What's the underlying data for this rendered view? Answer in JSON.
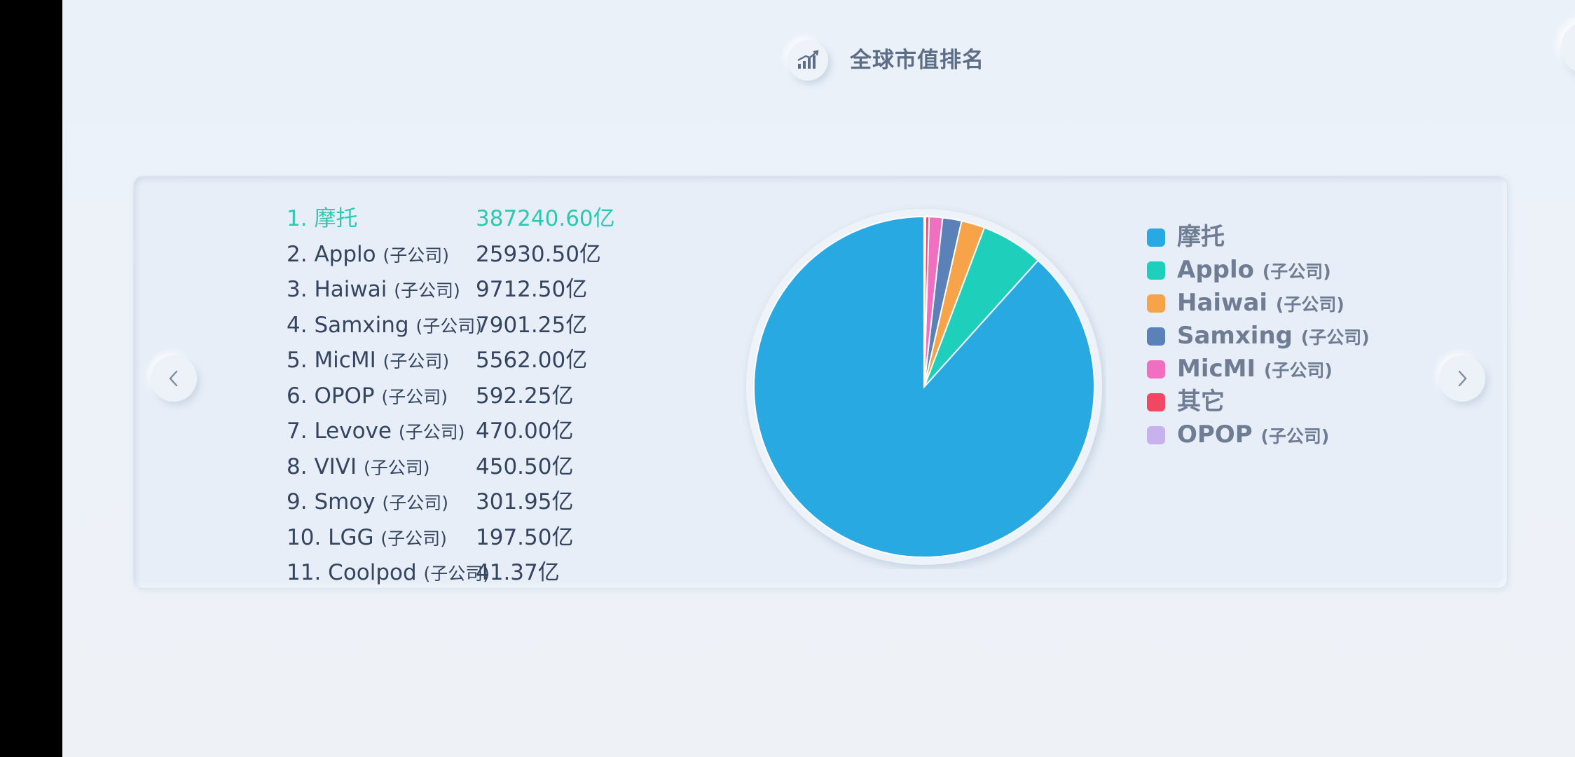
{
  "header": {
    "title": "全球市值排名",
    "icon": "trend-chart-icon"
  },
  "colors": {
    "accent": "#2cc9b0",
    "text": "#34455f",
    "legend_text": "#6f7d94"
  },
  "ranking": [
    {
      "rank": "1.",
      "name": "摩托",
      "suffix": "",
      "value": "387240.60亿"
    },
    {
      "rank": "2.",
      "name": "Applo",
      "suffix": "(子公司)",
      "value": "25930.50亿"
    },
    {
      "rank": "3.",
      "name": "Haiwai",
      "suffix": "(子公司)",
      "value": "9712.50亿"
    },
    {
      "rank": "4.",
      "name": "Samxing",
      "suffix": "(子公司)",
      "value": "7901.25亿"
    },
    {
      "rank": "5.",
      "name": "MicMI",
      "suffix": "(子公司)",
      "value": "5562.00亿"
    },
    {
      "rank": "6.",
      "name": "OPOP",
      "suffix": "(子公司)",
      "value": "592.25亿"
    },
    {
      "rank": "7.",
      "name": "Levove",
      "suffix": "(子公司)",
      "value": "470.00亿"
    },
    {
      "rank": "8.",
      "name": "VIVI",
      "suffix": "(子公司)",
      "value": "450.50亿"
    },
    {
      "rank": "9.",
      "name": "Smoy",
      "suffix": "(子公司)",
      "value": "301.95亿"
    },
    {
      "rank": "10.",
      "name": "LGG",
      "suffix": "(子公司)",
      "value": "197.50亿"
    },
    {
      "rank": "11.",
      "name": "Coolpod",
      "suffix": "(子公司)",
      "value": "41.37亿"
    }
  ],
  "legend": [
    {
      "name": "摩托",
      "suffix": "",
      "color": "#29a9e1"
    },
    {
      "name": "Applo",
      "suffix": "(子公司)",
      "color": "#1ecfbb"
    },
    {
      "name": "Haiwai",
      "suffix": "(子公司)",
      "color": "#f6a34a"
    },
    {
      "name": "Samxing",
      "suffix": "(子公司)",
      "color": "#5b82b8"
    },
    {
      "name": "MicMI",
      "suffix": "(子公司)",
      "color": "#f06fc0"
    },
    {
      "name": "其它",
      "suffix": "",
      "color": "#f04862"
    },
    {
      "name": "OPOP",
      "suffix": "(子公司)",
      "color": "#c8b2ee"
    }
  ],
  "chart_data": {
    "type": "pie",
    "slices": [
      {
        "name": "摩托",
        "value": 387240.6,
        "color": "#29a9e1"
      },
      {
        "name": "Applo",
        "value": 25930.5,
        "color": "#1ecfbb"
      },
      {
        "name": "Haiwai",
        "value": 9712.5,
        "color": "#f6a34a"
      },
      {
        "name": "Samxing",
        "value": 7901.25,
        "color": "#5b82b8"
      },
      {
        "name": "MicMI",
        "value": 5562.0,
        "color": "#f06fc0"
      },
      {
        "name": "其它",
        "value": 1461.32,
        "color": "#f04862"
      },
      {
        "name": "OPOP",
        "value": 592.25,
        "color": "#c8b2ee"
      }
    ],
    "legend_position": "right"
  }
}
